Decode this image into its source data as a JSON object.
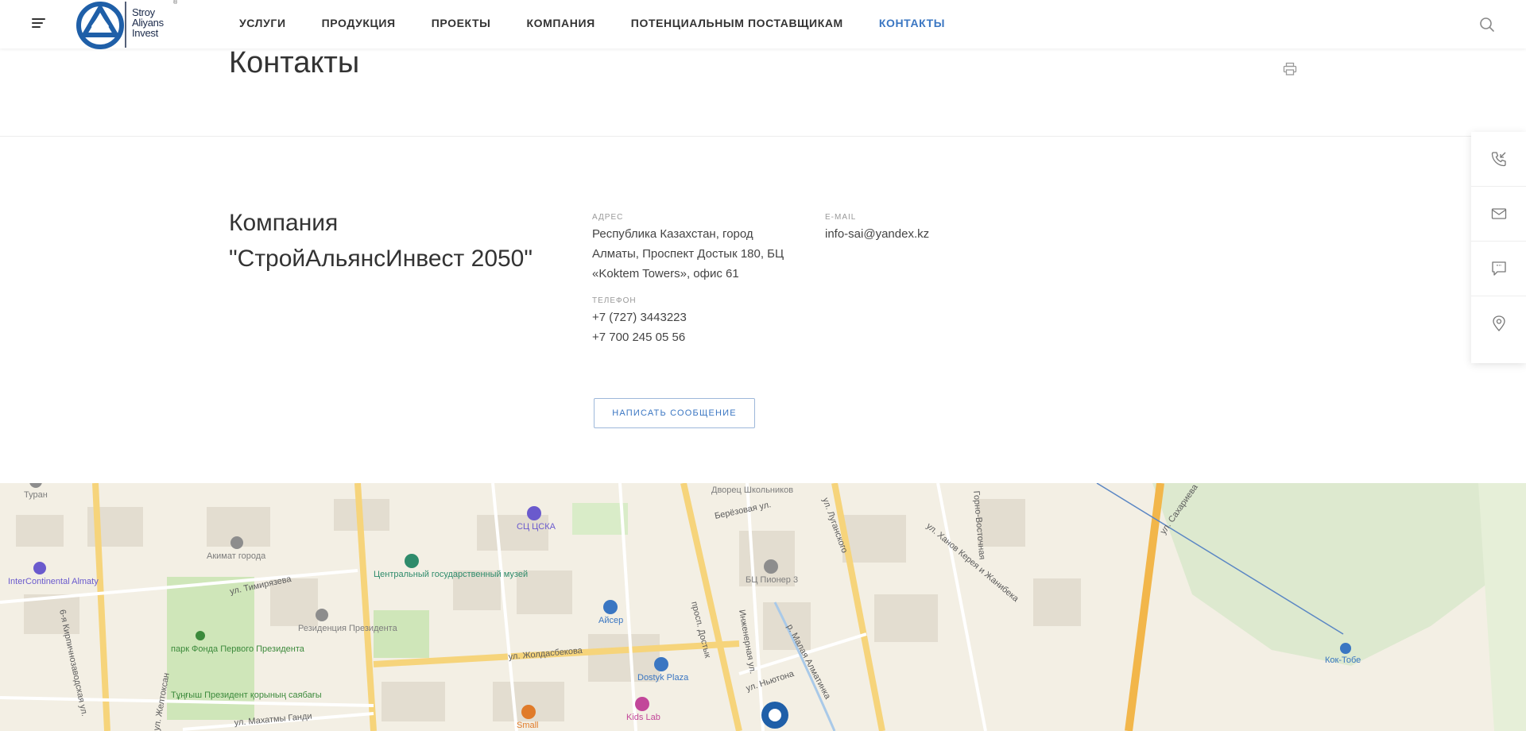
{
  "header": {
    "logo_text": [
      "Stroy",
      "Aliyans",
      "Invest"
    ],
    "logo_reg": "®",
    "nav": [
      {
        "label": "УСЛУГИ",
        "active": false
      },
      {
        "label": "ПРОДУКЦИЯ",
        "active": false
      },
      {
        "label": "ПРОЕКТЫ",
        "active": false
      },
      {
        "label": "КОМПАНИЯ",
        "active": false
      },
      {
        "label": "ПОТЕНЦИАЛЬНЫМ ПОСТАВЩИКАМ",
        "active": false
      },
      {
        "label": "КОНТАКТЫ",
        "active": true
      }
    ]
  },
  "page": {
    "title": "Контакты"
  },
  "contacts": {
    "company_line1": "Компания",
    "company_line2": "\"СтройАльянсИнвест 2050\"",
    "address_label": "АДРЕС",
    "address_lines": [
      "Республика Казахстан, город",
      "Алматы, Проспект Достык 180, БЦ",
      "«Koktem Towers», офис 61"
    ],
    "email_label": "E-MAIL",
    "email": "info-sai@yandex.kz",
    "phone_label": "ТЕЛЕФОН",
    "phones": [
      "+7 (727) 3443223",
      "+7 700 245 05 56"
    ],
    "message_button": "НАПИСАТЬ СООБЩЕНИЕ"
  },
  "map": {
    "streets": [
      "ул. Тимирязева",
      "ул. Жолдасбекова",
      "просп. Достык",
      "Инженерная ул.",
      "ул. Ньютона",
      "р. Малая Алматинка",
      "ул. Луганского",
      "Берёзовая ул.",
      "ул. Ханов Керея и Жанибека",
      "ул. Сахариева",
      "ул. Махатмы Ганди",
      "ул. Желтоксан",
      "6-я Кирпичнозаводская ул.",
      "Горно-Восточная"
    ],
    "pois": [
      {
        "name": "Туран",
        "color": "#7d7d7d"
      },
      {
        "name": "InterContinental Almaty",
        "color": "#6a5acd"
      },
      {
        "name": "Акимат города",
        "color": "#7d7d7d"
      },
      {
        "name": "Резиденция Президента",
        "color": "#7d7d7d"
      },
      {
        "name": "парк Фонда Первого Президента",
        "color": "#3c8a3c"
      },
      {
        "name": "Тұңғыш Президент қорының саябағы",
        "color": "#3c8a3c"
      },
      {
        "name": "Центральный государственный музей",
        "color": "#2e8b6b"
      },
      {
        "name": "СЦ ЦСКА",
        "color": "#6a5acd"
      },
      {
        "name": "Айсер",
        "color": "#3a76c2"
      },
      {
        "name": "Dostyk Plaza",
        "color": "#3a76c2"
      },
      {
        "name": "Kids Lab",
        "color": "#c2479a"
      },
      {
        "name": "Small",
        "color": "#e07b2a"
      },
      {
        "name": "БЦ Пионер 3",
        "color": "#7d7d7d"
      },
      {
        "name": "Дворец Школьников",
        "color": "#7d7d7d"
      },
      {
        "name": "Кок-Тобе",
        "color": "#3a76c2"
      }
    ]
  }
}
